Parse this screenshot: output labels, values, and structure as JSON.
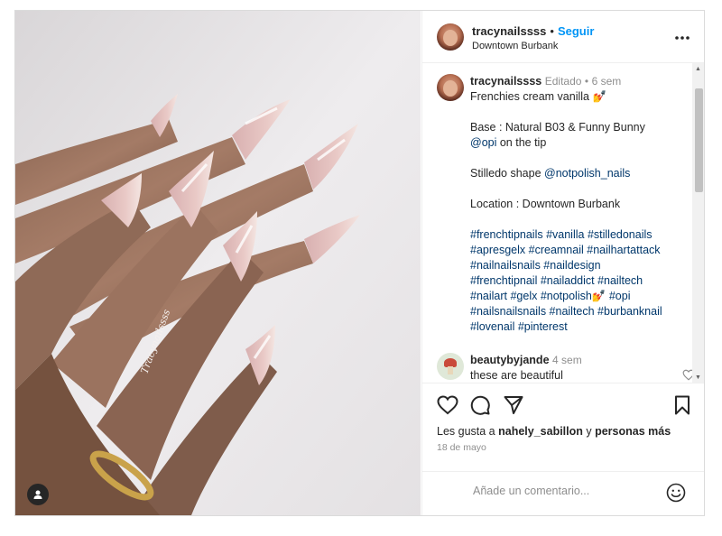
{
  "post": {
    "username": "tracynailssss",
    "separator": "•",
    "follow_label": "Seguir",
    "location": "Downtown Burbank",
    "more_icon": "more-horizontal-icon",
    "watermark": "Tracynailssss"
  },
  "caption": {
    "username": "tracynailssss",
    "edited": "Editado",
    "separator": "•",
    "time": "6 sem",
    "line1": "Frenchies cream vanilla 💅",
    "line2a": "Base : Natural B03 & Funny Bunny",
    "line2b_mention": "@opi",
    "line2b_rest": " on the tip",
    "line3_text": "Stilledo shape ",
    "line3_mention": "@notpolish_nails",
    "line4": "Location : Downtown Burbank",
    "hashtags": [
      "#frenchtipnails #vanilla #stilledonails",
      "#apresgelx #creamnail #nailhartattack",
      "#nailnailsnails #naildesign",
      "#frenchtipnail #nailaddict #nailtech",
      "#nailart #gelx #notpolish💅 #opi",
      "#nailsnailsnails #nailtech #burbanknail",
      "#lovenail #pinterest"
    ]
  },
  "comment": {
    "username": "beautybyjande",
    "time": "4 sem",
    "text": "these are beautiful"
  },
  "likes": {
    "prefix": "Les gusta a ",
    "user": "nahely_sabillon",
    "suffix": " y ",
    "others": "personas más"
  },
  "date": "18 de mayo",
  "add_comment": {
    "placeholder": "Añade un comentario..."
  },
  "icons": {
    "like": "heart-icon",
    "comment": "comment-icon",
    "share": "send-icon",
    "save": "bookmark-icon",
    "emoji": "emoji-icon",
    "tag": "user-tag-icon"
  }
}
